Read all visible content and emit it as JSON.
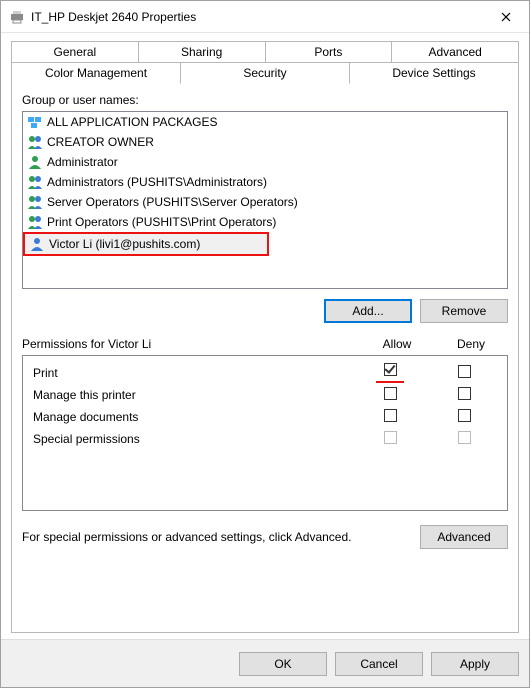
{
  "window": {
    "title": "IT_HP Deskjet 2640 Properties"
  },
  "tabs": {
    "row1": [
      "General",
      "Sharing",
      "Ports",
      "Advanced"
    ],
    "row2": [
      "Color Management",
      "Security",
      "Device Settings"
    ],
    "active": "Security"
  },
  "group_label": "Group or user names:",
  "groups": [
    {
      "icon": "packages-icon",
      "label": "ALL APPLICATION PACKAGES"
    },
    {
      "icon": "group-icon",
      "label": "CREATOR OWNER"
    },
    {
      "icon": "user-icon",
      "label": "Administrator"
    },
    {
      "icon": "group-icon",
      "label": "Administrators (PUSHITS\\Administrators)"
    },
    {
      "icon": "group-icon",
      "label": "Server Operators (PUSHITS\\Server Operators)"
    },
    {
      "icon": "group-icon",
      "label": "Print Operators (PUSHITS\\Print Operators)"
    },
    {
      "icon": "user-icon",
      "label": "Victor Li (livi1@pushits.com)"
    }
  ],
  "buttons": {
    "add": "Add...",
    "remove": "Remove",
    "advanced": "Advanced",
    "ok": "OK",
    "cancel": "Cancel",
    "apply": "Apply"
  },
  "perm_header": {
    "label": "Permissions for Victor Li",
    "allow": "Allow",
    "deny": "Deny"
  },
  "permissions": [
    {
      "name": "Print",
      "allow": true,
      "deny": false,
      "highlight_allow": true
    },
    {
      "name": "Manage this printer",
      "allow": false,
      "deny": false
    },
    {
      "name": "Manage documents",
      "allow": false,
      "deny": false
    },
    {
      "name": "Special permissions",
      "allow": false,
      "deny": false,
      "disabled": true
    }
  ],
  "adv_text": "For special permissions or advanced settings, click Advanced."
}
